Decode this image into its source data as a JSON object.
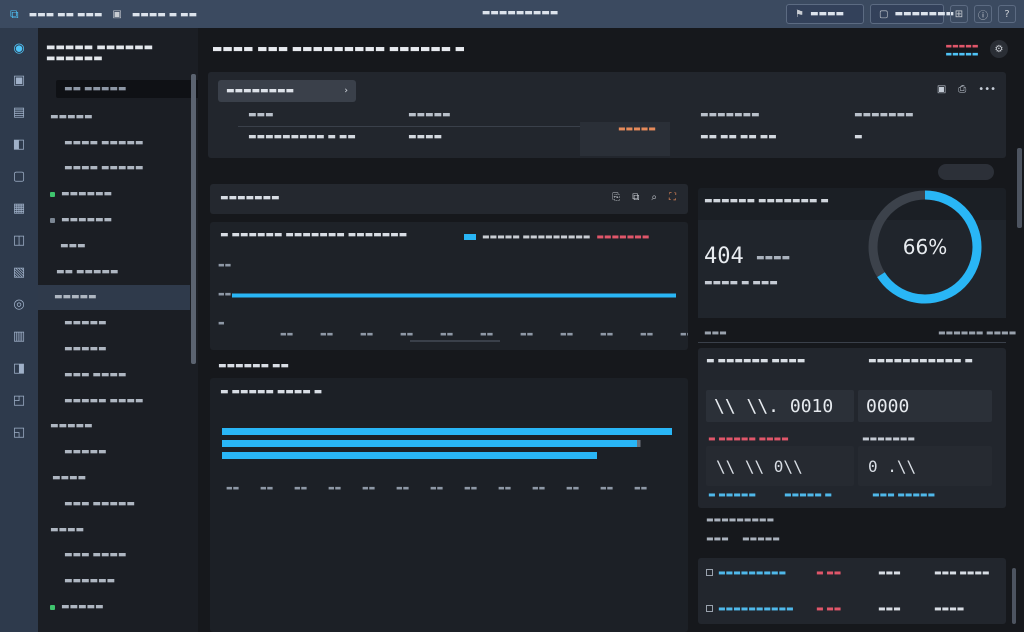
{
  "titlebar": {
    "app_name": "▬▬▬ ▬▬ ▬▬▬",
    "menu_label": "▬▬▬▬ ▬ ▬▬",
    "window_title": "▬▬▬▬▬▬▬▬▬",
    "btn1_label": "▬▬▬▬",
    "btn2_label": "▬▬▬▬▬▬▬"
  },
  "rail": {
    "items": [
      "◉",
      "▣",
      "▤",
      "◧",
      "▢",
      "▦",
      "◫",
      "▧",
      "◎",
      "▥",
      "◨",
      "◰",
      "◱"
    ]
  },
  "sidebar": {
    "header": "▬▬▬▬▬ ▬▬▬▬▬▬ ▬▬▬▬▬▬",
    "search_placeholder": "▬▬ ▬▬▬▬▬",
    "items": [
      {
        "label": "▬▬▬▬▬",
        "indent": 12,
        "dot": ""
      },
      {
        "label": "▬▬▬▬ ▬▬▬▬▬",
        "indent": 26,
        "dot": ""
      },
      {
        "label": "▬▬▬▬ ▬▬▬▬▬",
        "indent": 26,
        "dot": ""
      },
      {
        "label": "▬▬▬▬▬▬",
        "indent": 12,
        "dot": "#3ec46d"
      },
      {
        "label": "▬▬▬▬▬▬",
        "indent": 12,
        "dot": "#7c8794"
      },
      {
        "label": "▬▬▬",
        "indent": 22,
        "dot": ""
      },
      {
        "label": "▬▬ ▬▬▬▬▬",
        "indent": 18,
        "dot": ""
      },
      {
        "label": "▬▬▬▬▬",
        "indent": 16,
        "dot": "",
        "active": true
      },
      {
        "label": "▬▬▬▬▬",
        "indent": 26,
        "dot": ""
      },
      {
        "label": "▬▬▬▬▬",
        "indent": 26,
        "dot": ""
      },
      {
        "label": "▬▬▬ ▬▬▬▬",
        "indent": 26,
        "dot": ""
      },
      {
        "label": "▬▬▬▬▬ ▬▬▬▬",
        "indent": 26,
        "dot": ""
      },
      {
        "label": "▬▬▬▬▬",
        "indent": 12,
        "dot": ""
      },
      {
        "label": "▬▬▬▬▬",
        "indent": 26,
        "dot": ""
      },
      {
        "label": "▬▬▬▬",
        "indent": 14,
        "dot": ""
      },
      {
        "label": "▬▬▬ ▬▬▬▬▬",
        "indent": 26,
        "dot": ""
      },
      {
        "label": "▬▬▬▬",
        "indent": 12,
        "dot": ""
      },
      {
        "label": "▬▬▬ ▬▬▬▬",
        "indent": 26,
        "dot": ""
      },
      {
        "label": "▬▬▬▬▬▬",
        "indent": 26,
        "dot": ""
      },
      {
        "label": "▬▬▬▬▬",
        "indent": 12,
        "dot": "#3ec46d"
      }
    ]
  },
  "main": {
    "breadcrumb": "▬▬▬▬ ▬▬▬ ▬▬▬▬▬▬▬▬▬ ▬▬▬▬▬▬ ▬",
    "logo_top": "▬▬▬▬▬",
    "logo_bottom": "▬▬▬▬▬",
    "filter_chip": "▬▬▬▬▬▬▬▬",
    "filter_cols": [
      {
        "head": "▬▬▬",
        "val": "▬▬▬▬▬▬▬▬▬ ▬ ▬▬",
        "x": 40
      },
      {
        "head": "▬▬▬▬▬",
        "val": "▬▬▬▬",
        "x": 200
      },
      {
        "head": "▬▬▬▬▬▬▬",
        "val": "▬▬ ▬▬ ▬▬ ▬▬",
        "x": 492
      },
      {
        "head": "▬▬▬▬▬▬▬",
        "val": "▬",
        "x": 646
      }
    ],
    "filter_mini": "▬▬▬▬▬",
    "chart1_title": "▬▬▬▬▬▬▬",
    "chart1_sub": "▬ ▬▬▬▬▬▬ ▬▬▬▬▬▬▬ ▬▬▬▬▬▬▬",
    "legend_a": "▬▬▬▬▬ ▬▬▬▬▬▬▬▬▬",
    "legend_b": "▬▬▬▬▬▬▬",
    "chart2_label": "▬▬▬▬▬▬ ▬▬",
    "chart2_title": "▬ ▬▬▬▬▬ ▬▬▬▬ ▬",
    "right_label": "▬▬▬▬▬▬ ▬▬▬▬▬▬▬ ▬",
    "big_value": "404",
    "big_unit": "▬▬▬▬",
    "big_sub": "▬▬▬▬ ▬ ▬▬▬",
    "gauge_text": "66%",
    "foot_left": "▬▬▬",
    "foot_right": "▬▬▬▬▬▬ ▬▬▬▬",
    "metrics_title_a": "▬ ▬▬▬▬▬▬ ▬▬▬▬",
    "metrics_title_b": "▬▬▬▬▬▬▬▬▬▬▬ ▬",
    "m1": "\\\\ \\\\. 0010",
    "m2": "0000",
    "m3": "\\\\ \\\\ 0\\\\",
    "m4": "0 .\\\\",
    "m_cap_a": "▬ ▬▬▬▬▬ ▬▬▬▬",
    "m_cap_b": "▬▬▬▬▬▬▬",
    "m_link_a": "▬ ▬▬▬▬▬",
    "m_link_b": "▬▬▬▬▬ ▬",
    "m_link_c": "▬▬▬ ▬▬▬▬▬",
    "below_a": "▬▬▬▬▬▬▬▬▬",
    "below_b": "▬▬▬",
    "below_c": "▬▬▬▬▬",
    "table_rows": [
      {
        "a": "▬▬▬▬▬▬▬▬▬",
        "b": "▬ ▬▬",
        "c": "▬▬▬",
        "d": "▬▬▬ ▬▬▬▬"
      },
      {
        "a": "▬▬▬▬▬▬▬▬▬▬",
        "b": "▬ ▬▬",
        "c": "▬▬▬",
        "d": "▬▬▬▬"
      }
    ]
  },
  "chart_data": [
    {
      "type": "line",
      "x": [
        "▬▬",
        "▬▬",
        "▬▬",
        "▬▬",
        "▬▬",
        "▬▬",
        "▬▬",
        "▬▬",
        "▬▬",
        "▬▬",
        "▬▬"
      ],
      "series": [
        {
          "values": [
            1,
            1,
            1,
            1,
            1,
            1,
            1,
            1,
            1,
            1,
            1
          ]
        }
      ],
      "ylim": [
        0,
        4
      ],
      "yticks": [
        "▬▬",
        "▬▬",
        "▬"
      ]
    },
    {
      "type": "bar",
      "orientation": "horizontal",
      "categories": [
        "▬",
        "▬",
        "▬"
      ],
      "values": [
        450,
        415,
        375
      ],
      "xlim": [
        0,
        450
      ],
      "xticks": [
        "▬▬",
        "▬▬",
        "▬▬",
        "▬▬",
        "▬▬",
        "▬▬",
        "▬▬",
        "▬▬",
        "▬▬",
        "▬▬",
        "▬▬",
        "▬▬",
        "▬▬"
      ]
    },
    {
      "type": "pie",
      "values": [
        66,
        34
      ],
      "labels": [
        "66%",
        ""
      ]
    }
  ],
  "colors": {
    "accent": "#29b6f6",
    "red": "#e0566a",
    "green": "#3ec46d",
    "orange": "#e58a5a",
    "track": "#3a404a"
  }
}
